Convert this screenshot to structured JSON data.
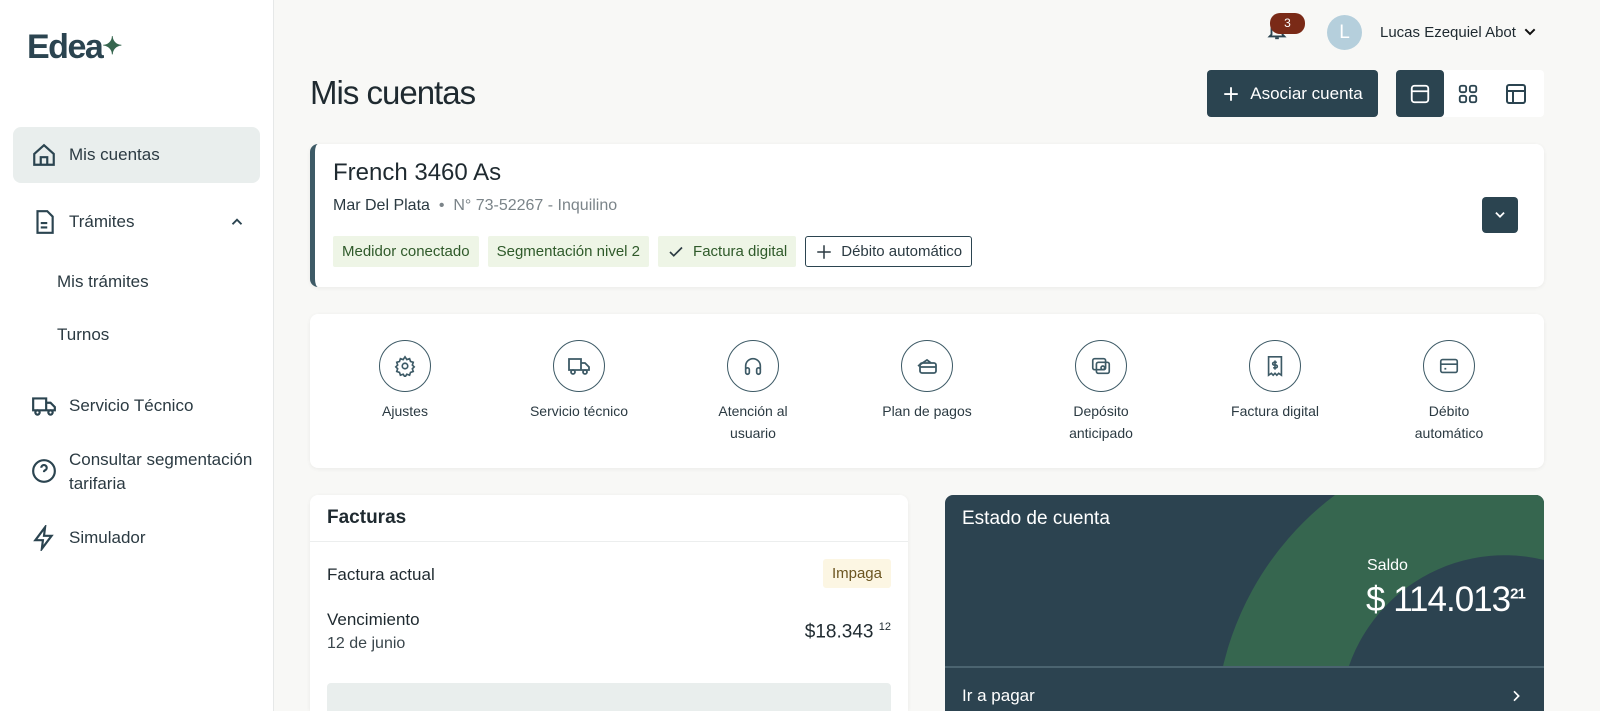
{
  "brand": {
    "name": "Edea",
    "mark": "✦"
  },
  "sidebar": {
    "items": [
      {
        "label": "Mis cuentas",
        "icon": "home-icon"
      },
      {
        "label": "Trámites",
        "icon": "document-icon"
      },
      {
        "label": "Mis trámites"
      },
      {
        "label": "Turnos"
      },
      {
        "label": "Servicio Técnico",
        "icon": "truck-icon"
      },
      {
        "label": "Consultar segmentación tarifaria",
        "icon": "help-icon"
      },
      {
        "label": "Simulador",
        "icon": "bolt-icon"
      }
    ]
  },
  "topbar": {
    "notifications": "3",
    "avatar_initial": "L",
    "user_name": "Lucas Ezequiel Abot"
  },
  "page": {
    "title": "Mis cuentas",
    "associate_label": "Asociar cuenta"
  },
  "account": {
    "address": "French 3460 As",
    "city": "Mar Del Plata",
    "number": "N° 73-52267 - Inquilino",
    "tags": [
      "Medidor conectado",
      "Segmentación nivel 2",
      "Factura digital"
    ],
    "add_tag": "Débito automático"
  },
  "actions": [
    {
      "label": "Ajustes",
      "icon": "gear-icon"
    },
    {
      "label": "Servicio técnico",
      "icon": "truck-icon"
    },
    {
      "label": "Atención al usuario",
      "icon": "headset-icon"
    },
    {
      "label": "Plan de pagos",
      "icon": "wallet-icon"
    },
    {
      "label": "Depósito anticipado",
      "icon": "cash-icon"
    },
    {
      "label": "Factura digital",
      "icon": "receipt-icon"
    },
    {
      "label": "Débito automático",
      "icon": "card-icon"
    }
  ],
  "facturas": {
    "title": "Facturas",
    "current_label": "Factura actual",
    "status": "Impaga",
    "due_label": "Vencimiento",
    "due_date": "12 de junio",
    "amount": "$18.343",
    "amount_cents": "12"
  },
  "estado": {
    "title": "Estado de cuenta",
    "balance_label": "Saldo",
    "balance": "$ 114.013",
    "balance_cents": "21",
    "pay_label": "Ir a pagar"
  },
  "colors": {
    "primary": "#2b4450",
    "accent": "#36664f",
    "alert": "#7a2a17"
  }
}
